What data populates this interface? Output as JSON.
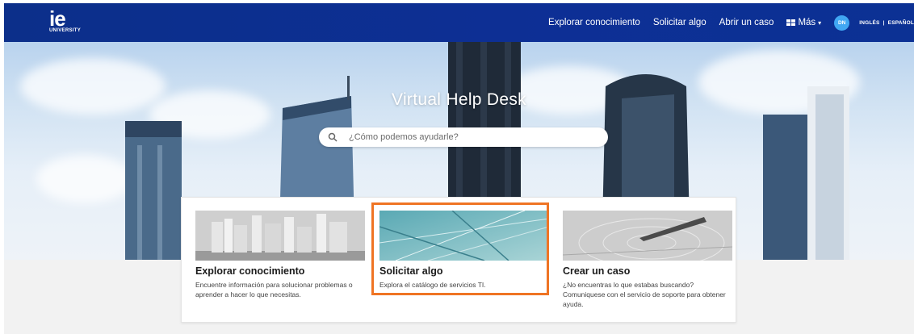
{
  "logo": {
    "main": "ie",
    "sub": "UNIVERSITY"
  },
  "nav": {
    "links": [
      "Explorar conocimiento",
      "Solicitar algo",
      "Abrir un caso"
    ],
    "more_label": "Más",
    "avatar_initials": "DN",
    "lang_a": "INGLÉS",
    "lang_sep": "|",
    "lang_b": "ESPAÑOL"
  },
  "hero": {
    "title": "Virtual Help Desk",
    "search_placeholder": "¿Cómo podemos ayudarle?"
  },
  "cards": [
    {
      "title": "Explorar conocimiento",
      "desc": "Encuentre información para solucionar problemas o aprender a hacer lo que necesitas.",
      "icon": "bookshelf-image"
    },
    {
      "title": "Solicitar algo",
      "desc": "Explora el catálogo de servicios TI.",
      "icon": "blueprint-image"
    },
    {
      "title": "Crear un caso",
      "desc": "¿No encuentras lo que estabas buscando? Comuniquese con el servicio de soporte para obtener ayuda.",
      "icon": "pen-image"
    }
  ],
  "colors": {
    "nav_bg": "#0d2f95",
    "accent_highlight": "#ef7424",
    "avatar_bg": "#41a7f3"
  }
}
